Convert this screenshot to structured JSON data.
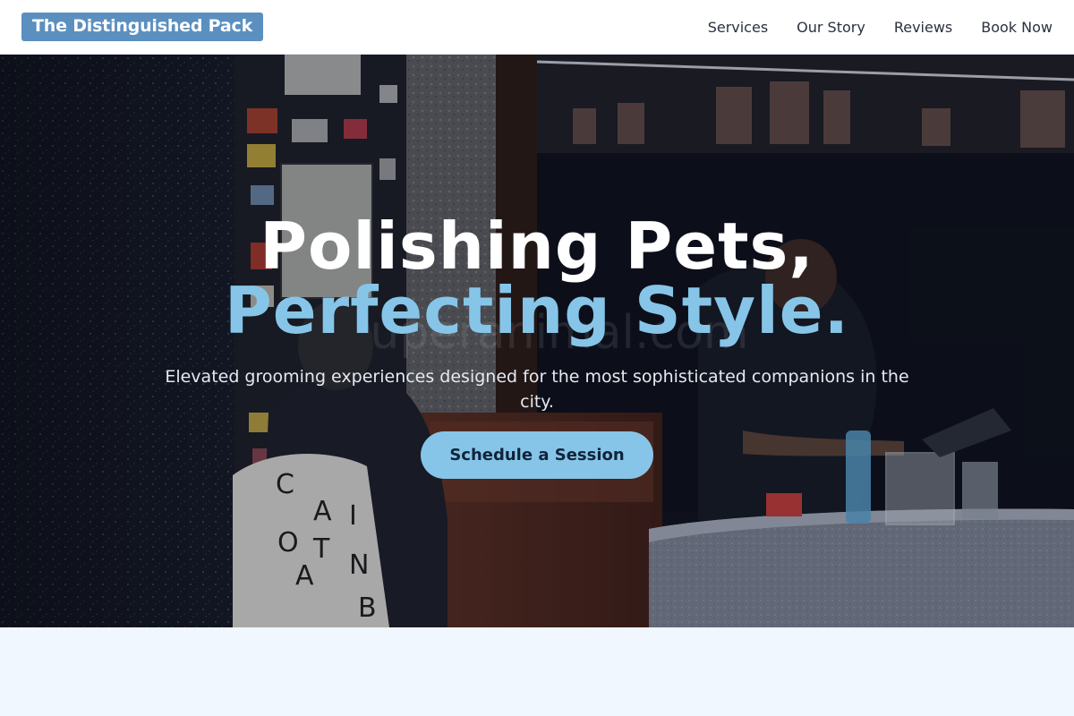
{
  "brand": {
    "name": "The Distinguished Pack"
  },
  "nav": {
    "items": [
      {
        "label": "Services"
      },
      {
        "label": "Our Story"
      },
      {
        "label": "Reviews"
      },
      {
        "label": "Book Now"
      }
    ]
  },
  "hero": {
    "title_line1": "Polishing Pets,",
    "title_line2": "Perfecting Style.",
    "subtitle": "Elevated grooming experiences designed for the most sophisticated companions in the city.",
    "cta_label": "Schedule a Session",
    "photo_watermark": "uperanimal.com",
    "bag_letters": "C A I O T I C A N C I A N C B"
  },
  "colors": {
    "brand_badge": "#5b8fbf",
    "accent": "#86c5e8",
    "hero_text": "#ffffff",
    "page_background": "#f0f7ff"
  }
}
